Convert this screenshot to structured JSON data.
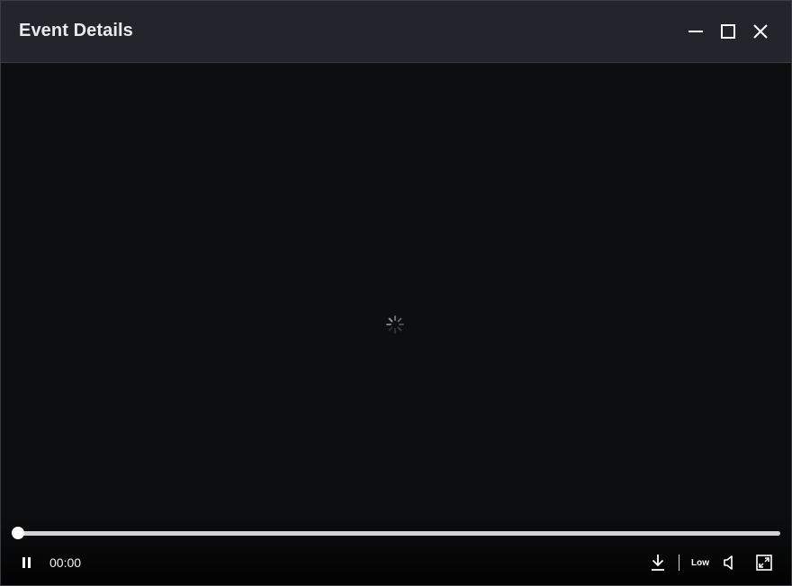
{
  "window": {
    "title": "Event Details",
    "controls": [
      "minimize-icon",
      "maximize-icon",
      "close-icon"
    ]
  },
  "player": {
    "state": "loading",
    "status": "paused-toggle",
    "current_time": "00:00",
    "progress": 0,
    "quality_label": "Low",
    "icons": {
      "play_pause": "pause-icon",
      "download": "download-icon",
      "volume": "volume-icon",
      "fullscreen": "fullscreen-icon",
      "loading": "spinner-icon"
    }
  },
  "colors": {
    "titlebar": "#22252b",
    "video_background": "#0d0e10",
    "text": "#e9eaec",
    "progress_track": "#d2d2d2"
  }
}
